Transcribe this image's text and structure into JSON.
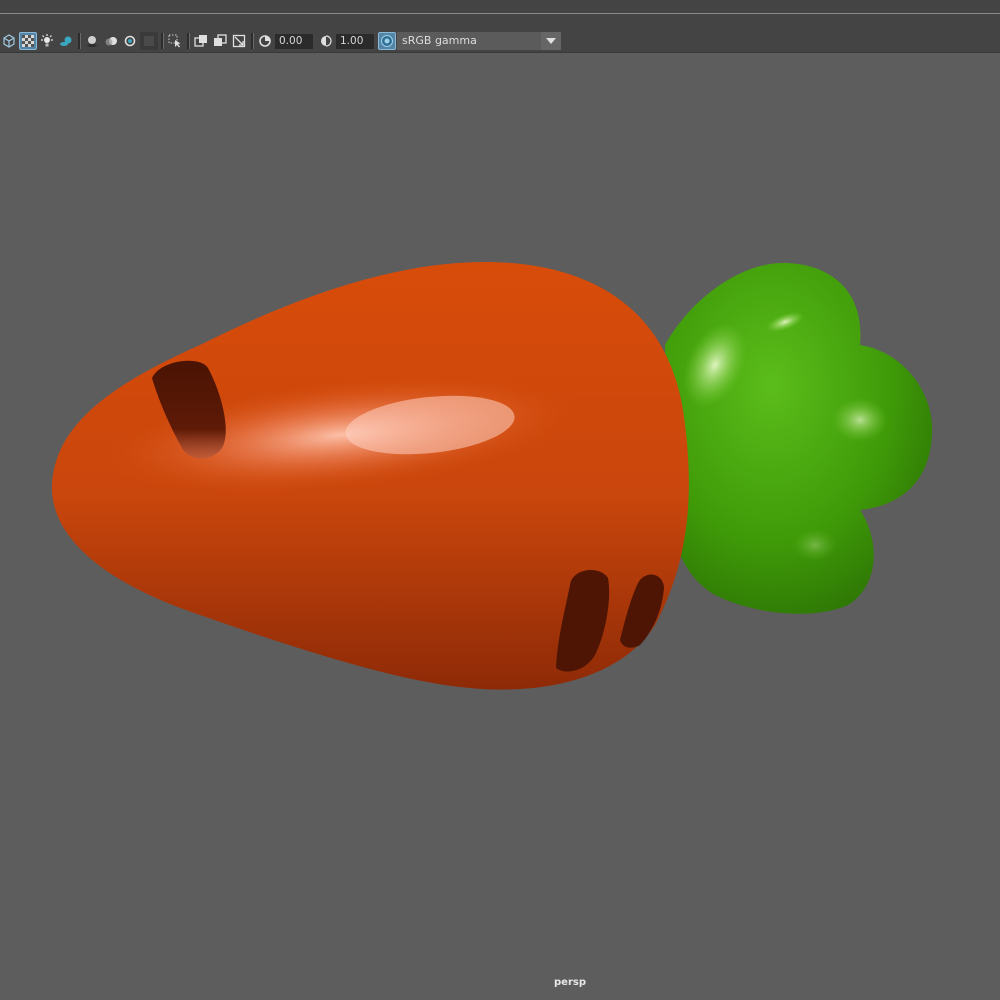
{
  "toolbar": {
    "buttons": [
      {
        "icon": "wireframe-cube-icon",
        "active": false
      },
      {
        "icon": "checker-texture-icon",
        "active": true
      },
      {
        "icon": "light-bulb-icon",
        "active": false
      },
      {
        "icon": "shadows-icon",
        "active": false
      },
      {
        "icon": "screen-space-ao-icon",
        "active": false
      },
      {
        "icon": "motion-blur-icon",
        "active": false
      },
      {
        "icon": "anti-aliasing-icon",
        "active": false
      },
      {
        "icon": "depth-of-field-icon",
        "active": false
      },
      {
        "icon": "isolate-select-icon",
        "active": false
      },
      {
        "icon": "xray-icon",
        "active": false
      },
      {
        "icon": "xray-active-components-icon",
        "active": false
      },
      {
        "icon": "xray-joints-icon",
        "active": false
      },
      {
        "icon": "exposure-icon",
        "active": false
      },
      {
        "icon": "gamma-icon",
        "active": false
      },
      {
        "icon": "color-management-icon",
        "active": true
      }
    ],
    "exposure_value": "0.00",
    "gamma_value": "1.00",
    "view_transform": "sRGB gamma"
  },
  "viewport": {
    "camera": "persp",
    "background_color": "#5d5d5d",
    "carrot_body_color": "#d14a0c",
    "carrot_leaves_color": "#3f9a08"
  }
}
